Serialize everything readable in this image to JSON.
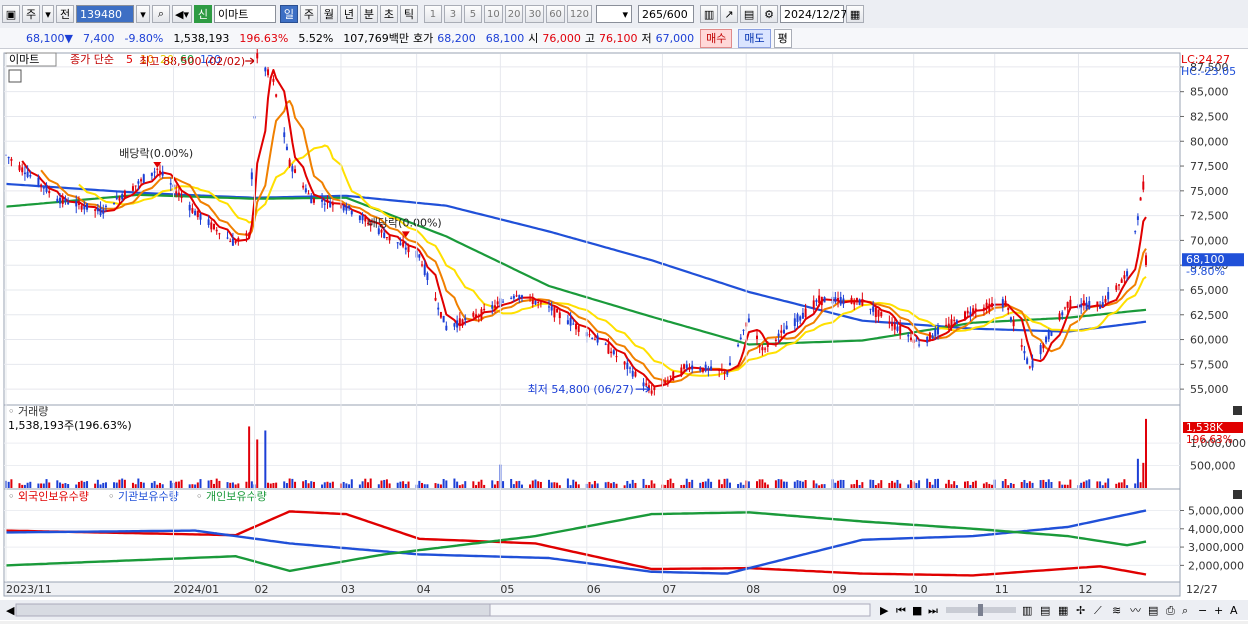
{
  "toolbar": {
    "market_label": "주",
    "prev_label": "전",
    "code_value": "139480",
    "name_badge": "신",
    "name_value": "이마트",
    "periods": [
      "일",
      "주",
      "월",
      "년",
      "분",
      "초",
      "틱"
    ],
    "selected_period": "일",
    "intervals": [
      "1",
      "3",
      "5",
      "10",
      "20",
      "30",
      "60",
      "120"
    ],
    "count_value": "265",
    "count_total": "/600",
    "date_value": "2024/12/27"
  },
  "quote": {
    "price": "68,100",
    "change_arrow": "▼",
    "change": "7,400",
    "change_pct": "-9.80%",
    "volume": "1,538,193",
    "volume_ratio": "196.63%",
    "turnover_rate": "5.52%",
    "amount": "107,769백만",
    "bid_label": "호가",
    "ask_price": "68,200",
    "bid_price": "68,100",
    "open_label": "시",
    "open": "76,000",
    "high_label": "고",
    "high": "76,100",
    "low_label": "저",
    "low": "67,000",
    "buy_label": "매수",
    "sell_label": "매도",
    "avg_label": "평"
  },
  "colors": {
    "up": "#e0000a",
    "down": "#1c3fd6",
    "ma5": "#e00000",
    "ma10": "#f08000",
    "ma20": "#ffe000",
    "ma60": "#1a9a3a",
    "ma120": "#2050d8"
  },
  "chart_data": [
    {
      "type": "candlestick",
      "title": "이마트",
      "legend": {
        "prefix": "종가 단순",
        "ma": [
          "5",
          "10",
          "20",
          "60",
          "120"
        ]
      },
      "x_ticks": [
        "2023/11",
        "2024/01",
        "02",
        "03",
        "04",
        "05",
        "06",
        "07",
        "08",
        "09",
        "10",
        "11",
        "12",
        "12/27"
      ],
      "y_ticks": [
        55000,
        57500,
        60000,
        62500,
        65000,
        67500,
        70000,
        72500,
        75000,
        77500,
        80000,
        82500,
        85000,
        87500
      ],
      "ylim": [
        53500,
        88800
      ],
      "right_top_labels": [
        "LC:24.27",
        "HC:-23.05"
      ],
      "current_price_label": "68,100",
      "current_change_label": "-9.80%",
      "annotations": [
        {
          "text": "최고 88,500 (02/02)",
          "x": "2024-02-02",
          "y": 88500
        },
        {
          "text": "최저 54,800 (06/27)",
          "x": "2024-06-27",
          "y": 54800
        },
        {
          "text": "배당락(0.00%)",
          "x": "2023-12-27",
          "y": 77000
        },
        {
          "text": "배당락(0.00%)",
          "x": "2024-03-28",
          "y": 70000
        }
      ],
      "close_path": [
        {
          "date": "2023-11-01",
          "close": 78600
        },
        {
          "date": "2023-11-20",
          "close": 74200
        },
        {
          "date": "2023-12-06",
          "close": 72900
        },
        {
          "date": "2023-12-27",
          "close": 77200
        },
        {
          "date": "2024-01-10",
          "close": 72800
        },
        {
          "date": "2024-01-24",
          "close": 69800
        },
        {
          "date": "2024-01-30",
          "close": 70500
        },
        {
          "date": "2024-02-02",
          "close": 88500
        },
        {
          "date": "2024-02-08",
          "close": 86000
        },
        {
          "date": "2024-02-14",
          "close": 77800
        },
        {
          "date": "2024-02-22",
          "close": 74200
        },
        {
          "date": "2024-03-06",
          "close": 73400
        },
        {
          "date": "2024-03-20",
          "close": 70600
        },
        {
          "date": "2024-04-02",
          "close": 68400
        },
        {
          "date": "2024-04-12",
          "close": 61200
        },
        {
          "date": "2024-04-24",
          "close": 62500
        },
        {
          "date": "2024-05-08",
          "close": 64600
        },
        {
          "date": "2024-05-20",
          "close": 63200
        },
        {
          "date": "2024-06-10",
          "close": 59400
        },
        {
          "date": "2024-06-27",
          "close": 54800
        },
        {
          "date": "2024-07-10",
          "close": 57300
        },
        {
          "date": "2024-07-25",
          "close": 56700
        },
        {
          "date": "2024-08-02",
          "close": 62100
        },
        {
          "date": "2024-08-07",
          "close": 58900
        },
        {
          "date": "2024-08-28",
          "close": 64000
        },
        {
          "date": "2024-09-13",
          "close": 63800
        },
        {
          "date": "2024-10-04",
          "close": 59600
        },
        {
          "date": "2024-10-24",
          "close": 63000
        },
        {
          "date": "2024-11-05",
          "close": 63700
        },
        {
          "date": "2024-11-14",
          "close": 57100
        },
        {
          "date": "2024-11-28",
          "close": 63600
        },
        {
          "date": "2024-12-10",
          "close": 63400
        },
        {
          "date": "2024-12-20",
          "close": 66500
        },
        {
          "date": "2024-12-26",
          "close": 75500
        },
        {
          "date": "2024-12-27",
          "close": 68100
        }
      ],
      "ma60_path": [
        {
          "date": "2023-11-01",
          "v": 73400
        },
        {
          "date": "2023-12-20",
          "v": 74600
        },
        {
          "date": "2024-02-01",
          "v": 74200
        },
        {
          "date": "2024-03-06",
          "v": 74300
        },
        {
          "date": "2024-04-12",
          "v": 70400
        },
        {
          "date": "2024-05-20",
          "v": 65400
        },
        {
          "date": "2024-06-27",
          "v": 62300
        },
        {
          "date": "2024-08-02",
          "v": 59500
        },
        {
          "date": "2024-09-13",
          "v": 59900
        },
        {
          "date": "2024-10-24",
          "v": 61700
        },
        {
          "date": "2024-11-28",
          "v": 62200
        },
        {
          "date": "2024-12-27",
          "v": 63000
        }
      ],
      "ma120_path": [
        {
          "date": "2023-11-01",
          "v": 75700
        },
        {
          "date": "2023-12-20",
          "v": 74800
        },
        {
          "date": "2024-02-01",
          "v": 74300
        },
        {
          "date": "2024-03-06",
          "v": 74500
        },
        {
          "date": "2024-04-12",
          "v": 73500
        },
        {
          "date": "2024-05-20",
          "v": 70900
        },
        {
          "date": "2024-06-27",
          "v": 68000
        },
        {
          "date": "2024-08-02",
          "v": 64800
        },
        {
          "date": "2024-09-13",
          "v": 61900
        },
        {
          "date": "2024-10-24",
          "v": 61100
        },
        {
          "date": "2024-11-28",
          "v": 60800
        },
        {
          "date": "2024-12-27",
          "v": 61800
        }
      ]
    },
    {
      "type": "bar",
      "title": "거래량",
      "value_label": "1,538,193주(196.63%)",
      "y_ticks": [
        500000,
        1000000
      ],
      "ylim": [
        0,
        1580000
      ],
      "current_label": "1,538K",
      "current_pct_label": "196.63%",
      "spikes": [
        {
          "date": "2024-01-30",
          "v": 1370000
        },
        {
          "date": "2024-02-02",
          "v": 1080000
        },
        {
          "date": "2024-02-05",
          "v": 1280000
        },
        {
          "date": "2024-05-02",
          "v": 520000
        },
        {
          "date": "2024-12-24",
          "v": 650000
        },
        {
          "date": "2024-12-26",
          "v": 560000
        },
        {
          "date": "2024-12-27",
          "v": 1538193
        }
      ],
      "base_volume": 170000
    },
    {
      "type": "line",
      "title": "",
      "series": [
        {
          "name": "외국인보유수량",
          "color": "#e00000",
          "points": [
            {
              "date": "2023-11-01",
              "v": 3900000
            },
            {
              "date": "2024-01-25",
              "v": 3650000
            },
            {
              "date": "2024-02-14",
              "v": 4950000
            },
            {
              "date": "2024-03-06",
              "v": 4800000
            },
            {
              "date": "2024-04-02",
              "v": 3450000
            },
            {
              "date": "2024-05-15",
              "v": 3200000
            },
            {
              "date": "2024-06-27",
              "v": 1800000
            },
            {
              "date": "2024-08-02",
              "v": 1850000
            },
            {
              "date": "2024-09-13",
              "v": 1550000
            },
            {
              "date": "2024-10-24",
              "v": 1450000
            },
            {
              "date": "2024-12-10",
              "v": 1950000
            },
            {
              "date": "2024-12-27",
              "v": 1500000
            }
          ]
        },
        {
          "name": "기관보유수량",
          "color": "#2050d8",
          "points": [
            {
              "date": "2023-11-01",
              "v": 3800000
            },
            {
              "date": "2024-01-10",
              "v": 3900000
            },
            {
              "date": "2024-02-14",
              "v": 3200000
            },
            {
              "date": "2024-04-02",
              "v": 2600000
            },
            {
              "date": "2024-05-20",
              "v": 2400000
            },
            {
              "date": "2024-06-27",
              "v": 1650000
            },
            {
              "date": "2024-07-25",
              "v": 1550000
            },
            {
              "date": "2024-09-13",
              "v": 3400000
            },
            {
              "date": "2024-10-24",
              "v": 3600000
            },
            {
              "date": "2024-11-28",
              "v": 4100000
            },
            {
              "date": "2024-12-27",
              "v": 5000000
            }
          ]
        },
        {
          "name": "개인보유수량",
          "color": "#1a9a3a",
          "points": [
            {
              "date": "2023-11-01",
              "v": 2000000
            },
            {
              "date": "2024-01-25",
              "v": 2500000
            },
            {
              "date": "2024-02-14",
              "v": 1700000
            },
            {
              "date": "2024-03-20",
              "v": 2600000
            },
            {
              "date": "2024-05-15",
              "v": 3600000
            },
            {
              "date": "2024-06-27",
              "v": 4800000
            },
            {
              "date": "2024-08-02",
              "v": 4900000
            },
            {
              "date": "2024-09-13",
              "v": 4400000
            },
            {
              "date": "2024-10-24",
              "v": 4000000
            },
            {
              "date": "2024-11-28",
              "v": 3600000
            },
            {
              "date": "2024-12-20",
              "v": 3100000
            },
            {
              "date": "2024-12-27",
              "v": 3300000
            }
          ]
        }
      ],
      "y_ticks": [
        2000000,
        3000000,
        4000000,
        5000000
      ],
      "ylim": [
        1200000,
        5300000
      ]
    }
  ]
}
